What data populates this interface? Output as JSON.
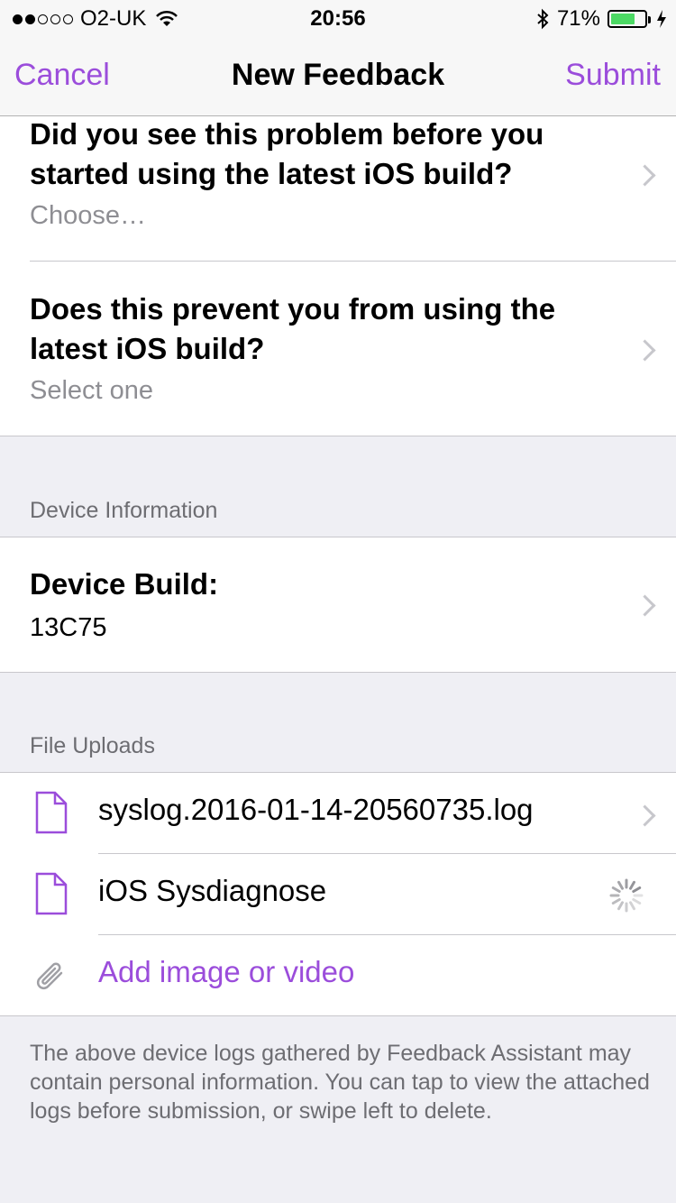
{
  "status_bar": {
    "carrier": "O2-UK",
    "time": "20:56",
    "battery_percent": "71%",
    "battery_level": 0.71,
    "battery_color": "#4cd964",
    "signal_bars": 2,
    "icons": [
      "wifi-icon",
      "bluetooth-icon",
      "battery-icon",
      "charging-icon"
    ]
  },
  "nav": {
    "cancel_label": "Cancel",
    "title": "New Feedback",
    "submit_label": "Submit",
    "accent_color": "#9b4ddb"
  },
  "questions": [
    {
      "question": "Did you see this problem before you started using the latest iOS build?",
      "value": "Choose…"
    },
    {
      "question": "Does this prevent you from using the latest iOS build?",
      "value": "Select one"
    }
  ],
  "device_section": {
    "header": "Device Information",
    "label": "Device Build:",
    "value": "13C75"
  },
  "uploads_section": {
    "header": "File Uploads",
    "files": [
      {
        "name": "syslog.2016-01-14-20560735.log",
        "status": "chevron"
      },
      {
        "name": "iOS Sysdiagnose",
        "status": "loading"
      }
    ],
    "add_label": "Add image or video"
  },
  "footer_note": "The above device logs gathered by Feedback Assistant may contain personal information. You can tap to view the attached logs before submission, or swipe left to delete."
}
